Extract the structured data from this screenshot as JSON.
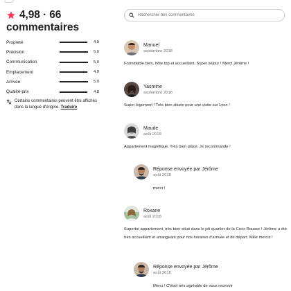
{
  "summary": {
    "rating": "4,98",
    "separator": "·",
    "count": "66",
    "count_label": "commentaires"
  },
  "ratings": [
    {
      "label": "Propreté",
      "value": "4,9",
      "score": 4.9
    },
    {
      "label": "Précision",
      "value": "5,0",
      "score": 5.0
    },
    {
      "label": "Communication",
      "value": "5,0",
      "score": 5.0
    },
    {
      "label": "Emplacement",
      "value": "4,9",
      "score": 4.9
    },
    {
      "label": "Arrivée",
      "value": "5,0",
      "score": 5.0
    },
    {
      "label": "Qualité-prix",
      "value": "4,8",
      "score": 4.8
    }
  ],
  "translate_note": {
    "text": "Certains commentaires peuvent être affichés dans la langue d'origine.",
    "link": "Traduire"
  },
  "search": {
    "placeholder": "Rechercher des commentaires"
  },
  "reviews": [
    {
      "name": "Manuel",
      "date": "septembre 2018",
      "text": "Formidable bien, hôte top et accueillant. Super séjour ! Merci Jérôme !"
    },
    {
      "name": "Yasmine",
      "date": "septembre 2018",
      "text": "Super logement ! Très bien située pour une visite sur Lyon !"
    },
    {
      "name": "Maude",
      "date": "août 2018",
      "text": "Appartement magnifique. Très bien placé. Je recommande !"
    },
    {
      "name": "Roxane",
      "date": "août 2018",
      "text": "Superbe appartement, très bien situé dans le joli quartier de la Croix Rousse ! Jérôme a été très accueillant et arrangeant pour nos horaires d'arrivée et de départ. Mille mercis !"
    }
  ],
  "replies": [
    {
      "name": "Réponse envoyée par Jérôme",
      "date": "août 2018",
      "text": "merci !"
    },
    {
      "name": "Réponse envoyée par Jérôme",
      "date": "août 2018",
      "text": "Merci ! C'était très agréable de vous recevoir"
    }
  ],
  "colors": {
    "star": "#FF385C",
    "text": "#222222",
    "muted": "#717171",
    "bar_bg": "#DDDDDD"
  }
}
